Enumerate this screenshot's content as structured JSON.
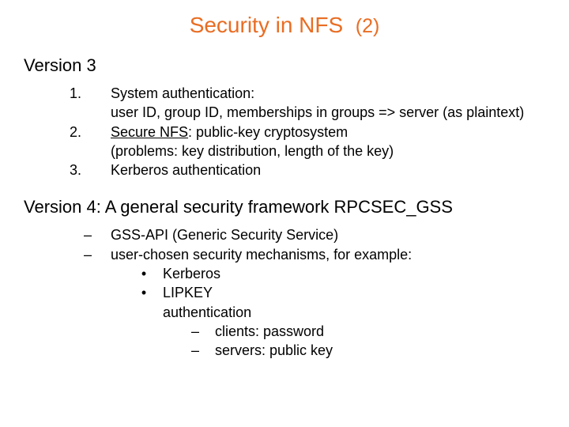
{
  "title_main": "Security in NFS",
  "title_part": "(2)",
  "v3": {
    "heading": "Version 3",
    "items": [
      {
        "marker": "1.",
        "line1": "System authentication:",
        "line2": "user ID, group ID,  memberships in groups => server (as plaintext)"
      },
      {
        "marker": "2.",
        "prefix": "Secure NFS",
        "suffix": ": public-key cryptosystem",
        "line2": "(problems: key distribution, length of the key)"
      },
      {
        "marker": "3.",
        "line1": "Kerberos authentication"
      }
    ]
  },
  "v4": {
    "heading": "Version 4:   A general security framework RPCSEC_GSS",
    "dash1": "GSS-API (Generic Security Service)",
    "dash2": "user-chosen security mechanisms, for example:",
    "bullets": [
      "Kerberos",
      "LIPKEY"
    ],
    "auth_label": "authentication",
    "sub": [
      "clients: password",
      "servers: public key"
    ]
  }
}
